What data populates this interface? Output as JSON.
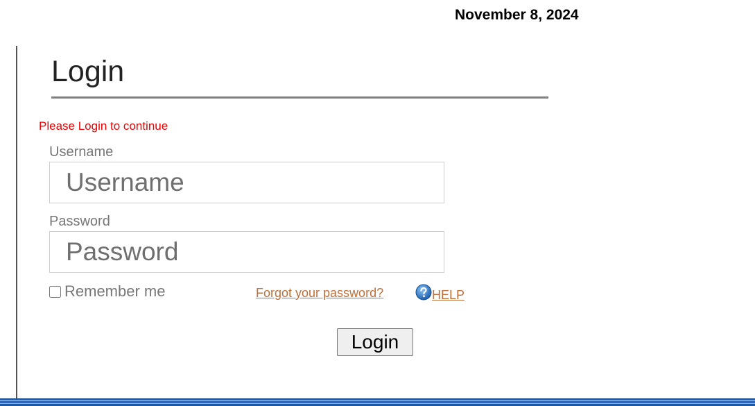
{
  "header": {
    "date": "November 8, 2024"
  },
  "login": {
    "title": "Login",
    "message": "Please Login to continue",
    "message_color": "#ee0000",
    "username": {
      "label": "Username",
      "placeholder": "Username",
      "value": ""
    },
    "password": {
      "label": "Password",
      "placeholder": "Password",
      "value": ""
    },
    "remember": {
      "label": "Remember me",
      "checked": false
    },
    "forgot_link": "Forgot your password?",
    "help": {
      "icon": "help-question-icon",
      "label": "HELP"
    },
    "submit_label": "Login",
    "link_color": "#c0703a"
  },
  "footer": {
    "bar_color": "#2f66b8"
  }
}
